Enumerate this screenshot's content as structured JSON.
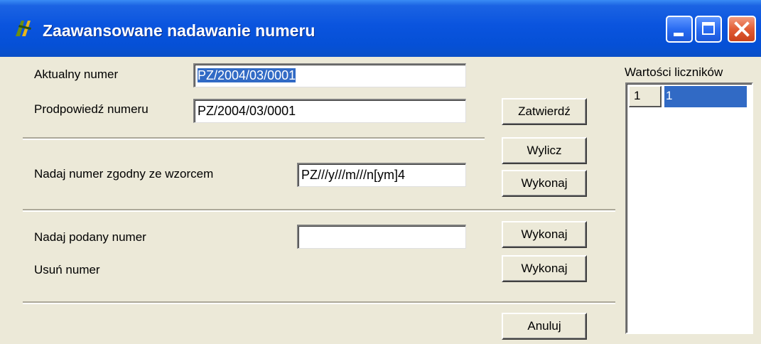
{
  "window": {
    "title": "Zaawansowane nadawanie numeru",
    "icon": "app-icon"
  },
  "current_number": {
    "label": "Aktualny numer",
    "value": "PZ/2004/03/0001"
  },
  "suggested_number": {
    "label": "Prodpowiedź numeru",
    "value": "PZ/2004/03/0001"
  },
  "pattern": {
    "label": "Nadaj numer zgodny ze wzorcem",
    "value": "PZ///y///m///n[ym]4"
  },
  "given_number": {
    "label": "Nadaj podany numer",
    "value": ""
  },
  "remove_number": {
    "label": "Usuń numer"
  },
  "buttons": {
    "confirm": "Zatwierdź",
    "calculate": "Wylicz",
    "execute_pattern": "Wykonaj",
    "execute_given": "Wykonaj",
    "execute_remove": "Wykonaj",
    "cancel": "Anuluj"
  },
  "counters": {
    "title": "Wartości liczników",
    "rows": [
      {
        "key": "1",
        "value": "1"
      }
    ]
  },
  "colors": {
    "titlebar": "#0a54de",
    "selection": "#316ac5",
    "window_bg": "#ece9d8"
  }
}
